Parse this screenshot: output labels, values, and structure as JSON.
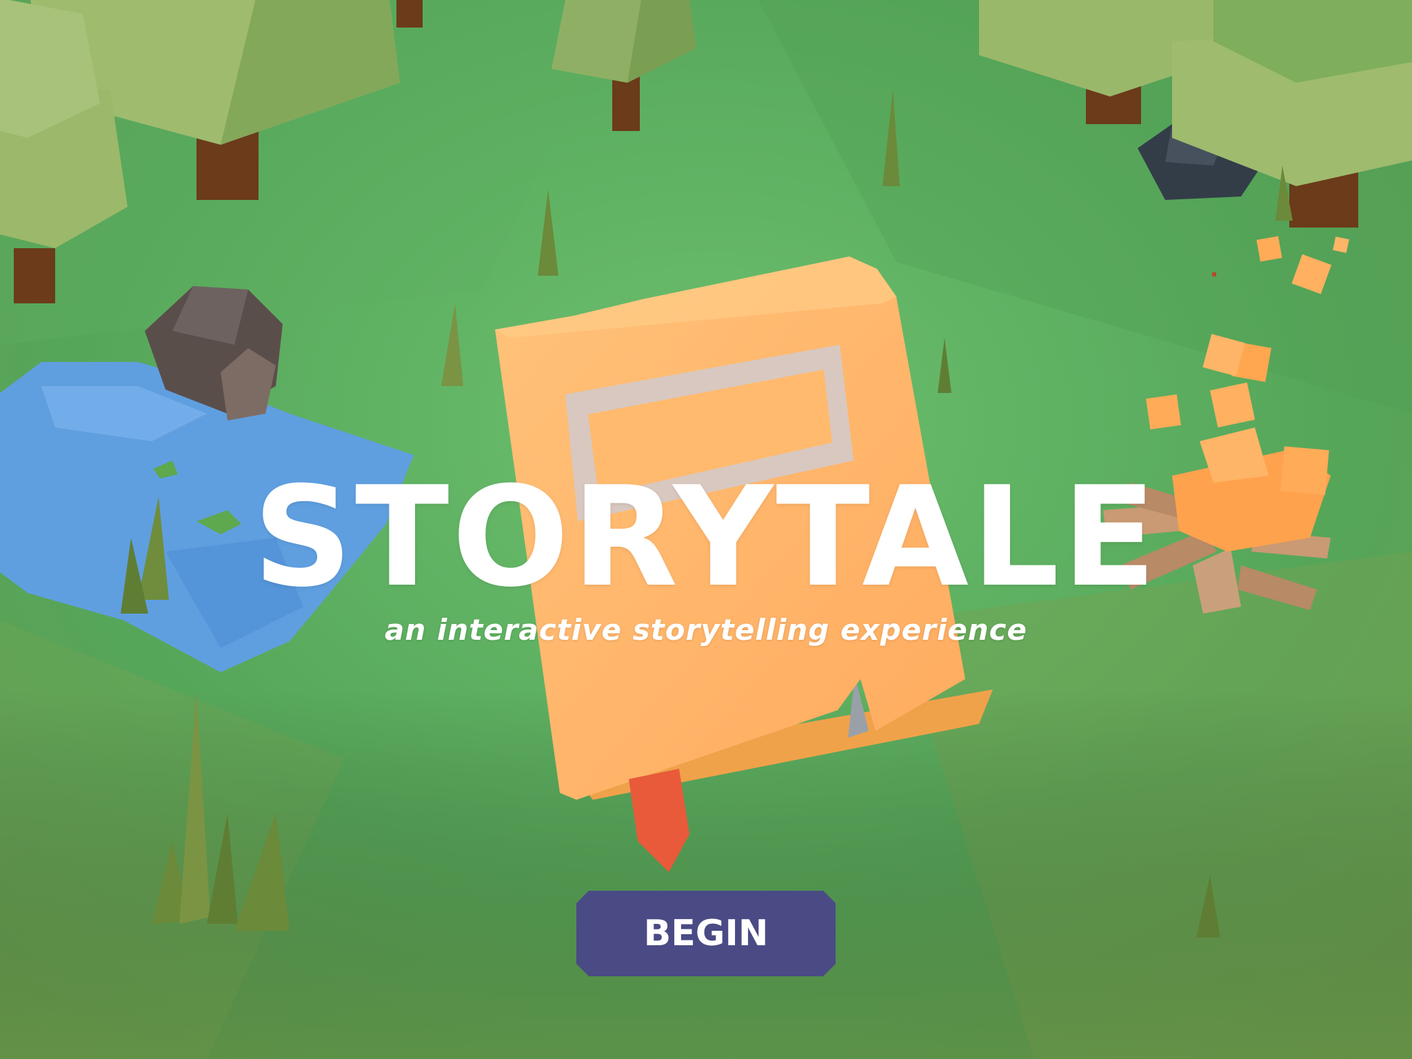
{
  "app": {
    "title": "STORYTALE",
    "subtitle": "an interactive storytelling experience"
  },
  "actions": {
    "begin_label": "BEGIN"
  },
  "colors": {
    "ground": "#5aa85a",
    "book": "#ffb366",
    "button": "#4a4a85",
    "water": "#5f9fe0",
    "title_text": "#ffffff"
  },
  "scene": {
    "elements": [
      "tree",
      "rock",
      "pond",
      "storybook",
      "bookmark",
      "campfire",
      "grass"
    ]
  }
}
